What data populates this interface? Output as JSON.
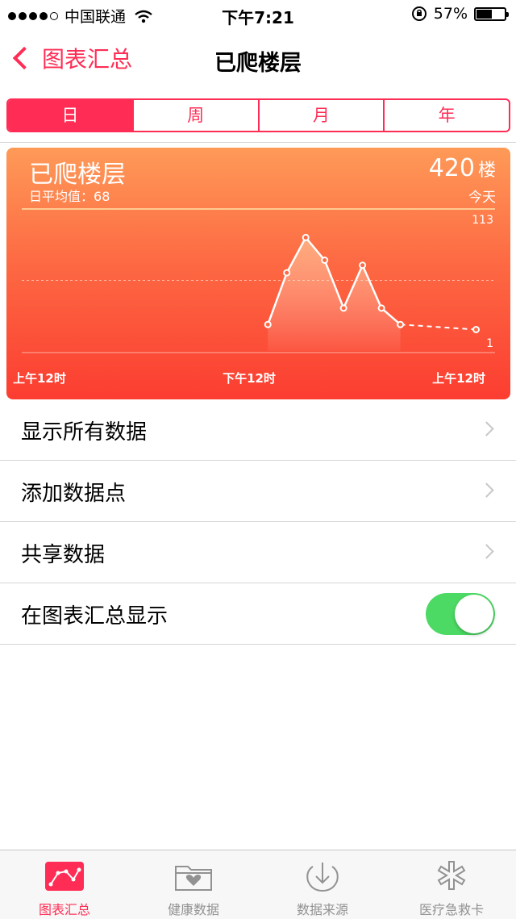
{
  "status_bar": {
    "carrier": "中国联通",
    "time": "下午7:21",
    "battery_percent": "57%",
    "battery_level": 0.57
  },
  "nav": {
    "back_label": "图表汇总",
    "title": "已爬楼层"
  },
  "segments": [
    "日",
    "周",
    "月",
    "年"
  ],
  "selected_segment": "日",
  "card": {
    "title": "已爬楼层",
    "average_label": "日平均值：",
    "average_value": "68",
    "total_value": "420",
    "total_unit": "楼",
    "period_label": "今天",
    "colors": {
      "top": "#fe9a58",
      "bottom": "#fc3d31"
    }
  },
  "chart_data": {
    "type": "line",
    "ylim": [
      1,
      113
    ],
    "y_tick_labels": [
      "113",
      "1"
    ],
    "x_tick_labels": [
      "上午12时",
      "下午12时",
      "上午12时"
    ],
    "x_hours": [
      13,
      14,
      15,
      16,
      17,
      18,
      19,
      20,
      24
    ],
    "values": [
      22,
      63,
      91,
      73,
      35,
      69,
      35,
      22,
      18
    ],
    "dashed_from_index": 7,
    "midline": 57
  },
  "list": {
    "show_all_data": "显示所有数据",
    "add_data_point": "添加数据点",
    "share_data": "共享数据",
    "show_on_dashboard": "在图表汇总显示",
    "show_on_dashboard_on": true
  },
  "tabbar": {
    "items": [
      {
        "label": "图表汇总",
        "icon": "chart-icon",
        "active": true
      },
      {
        "label": "健康数据",
        "icon": "health-data-folder-icon",
        "active": false
      },
      {
        "label": "数据来源",
        "icon": "data-source-icon",
        "active": false
      },
      {
        "label": "医疗急救卡",
        "icon": "medical-id-icon",
        "active": false
      }
    ],
    "accent": "#ff2d55",
    "inactive": "#929292"
  }
}
